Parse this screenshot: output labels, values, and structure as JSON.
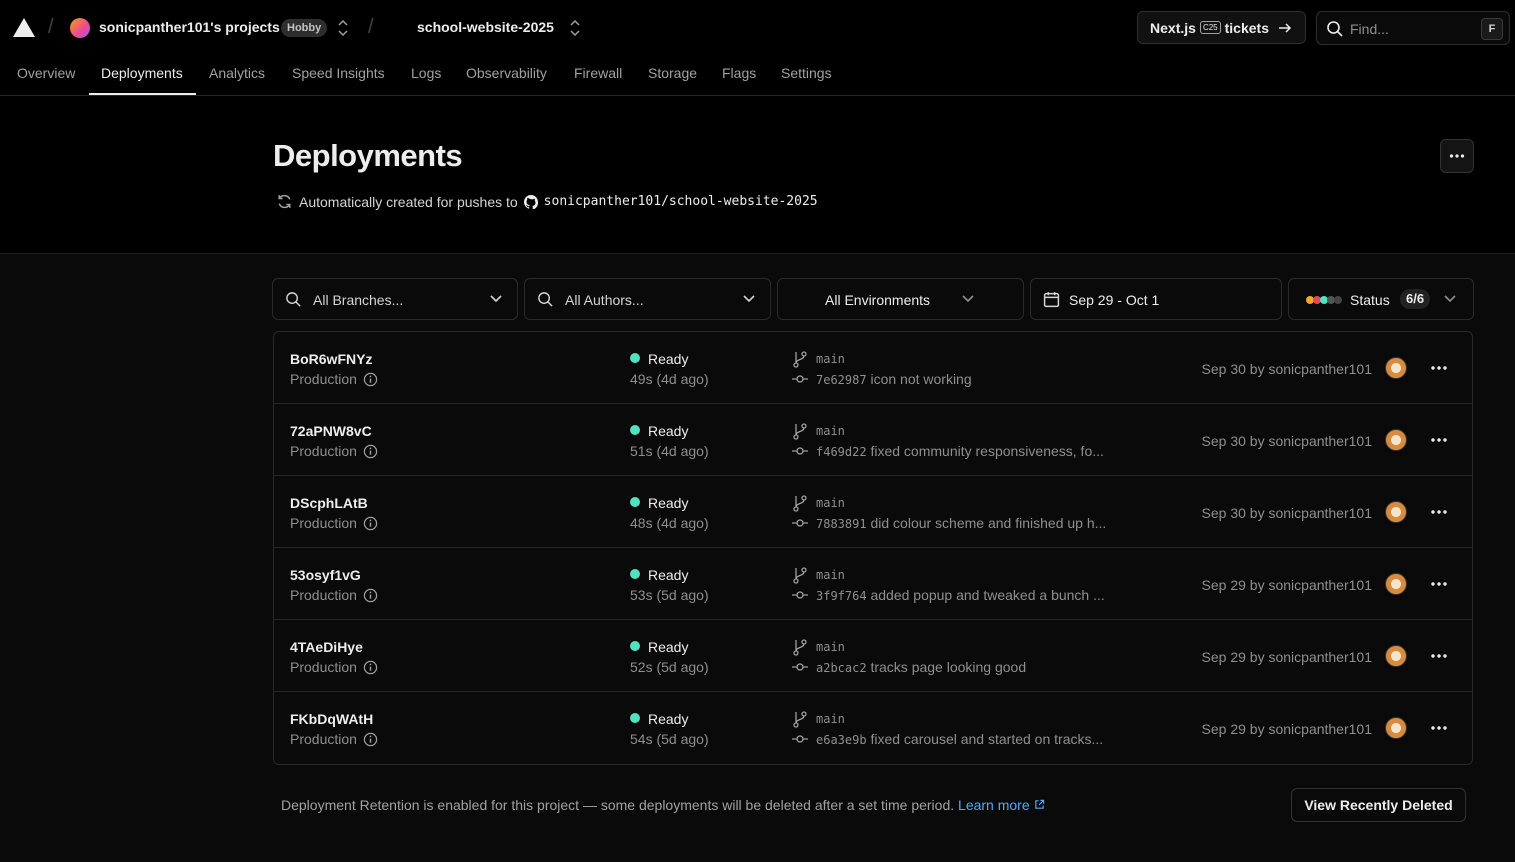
{
  "header": {
    "team_name": "sonicpanther101's projects",
    "plan_badge": "Hobby",
    "project_name": "school-website-2025",
    "promo": {
      "prefix": "Next.js",
      "badge": "C25",
      "suffix": "tickets"
    },
    "find_placeholder": "Find...",
    "find_shortcut": "F"
  },
  "tabs": [
    {
      "label": "Overview"
    },
    {
      "label": "Deployments",
      "active": true
    },
    {
      "label": "Analytics"
    },
    {
      "label": "Speed Insights"
    },
    {
      "label": "Logs"
    },
    {
      "label": "Observability"
    },
    {
      "label": "Firewall"
    },
    {
      "label": "Storage"
    },
    {
      "label": "Flags"
    },
    {
      "label": "Settings"
    }
  ],
  "page": {
    "title": "Deployments",
    "auto_text": "Automatically created for pushes to",
    "repo": "sonicpanther101/school-website-2025"
  },
  "filters": {
    "branches": "All Branches...",
    "authors": "All Authors...",
    "environments": "All Environments",
    "date_range": "Sep 29 - Oct 1",
    "status_label": "Status",
    "status_count": "6/6"
  },
  "deployments": [
    {
      "id": "BoR6wFNYz",
      "env": "Production",
      "status": "Ready",
      "duration": "49s (4d ago)",
      "branch": "main",
      "hash": "7e62987",
      "message": "icon not working",
      "meta": "Sep 30 by sonicpanther101"
    },
    {
      "id": "72aPNW8vC",
      "env": "Production",
      "status": "Ready",
      "duration": "51s (4d ago)",
      "branch": "main",
      "hash": "f469d22",
      "message": "fixed community responsiveness, fo...",
      "meta": "Sep 30 by sonicpanther101"
    },
    {
      "id": "DScphLAtB",
      "env": "Production",
      "status": "Ready",
      "duration": "48s (4d ago)",
      "branch": "main",
      "hash": "7883891",
      "message": "did colour scheme and finished up h...",
      "meta": "Sep 30 by sonicpanther101"
    },
    {
      "id": "53osyf1vG",
      "env": "Production",
      "status": "Ready",
      "duration": "53s (5d ago)",
      "branch": "main",
      "hash": "3f9f764",
      "message": "added popup and tweaked a bunch ...",
      "meta": "Sep 29 by sonicpanther101"
    },
    {
      "id": "4TAeDiHye",
      "env": "Production",
      "status": "Ready",
      "duration": "52s (5d ago)",
      "branch": "main",
      "hash": "a2bcac2",
      "message": "tracks page looking good",
      "meta": "Sep 29 by sonicpanther101"
    },
    {
      "id": "FKbDqWAtH",
      "env": "Production",
      "status": "Ready",
      "duration": "54s (5d ago)",
      "branch": "main",
      "hash": "e6a3e9b",
      "message": "fixed carousel and started on tracks...",
      "meta": "Sep 29 by sonicpanther101"
    }
  ],
  "footer": {
    "retention_text": "Deployment Retention is enabled for this project — some deployments will be deleted after a set time period.",
    "learn_more": "Learn more",
    "view_deleted": "View Recently Deleted"
  },
  "colors": {
    "ready": "#50e3c2",
    "link": "#52a8ff",
    "background": "#0a0a0a"
  }
}
